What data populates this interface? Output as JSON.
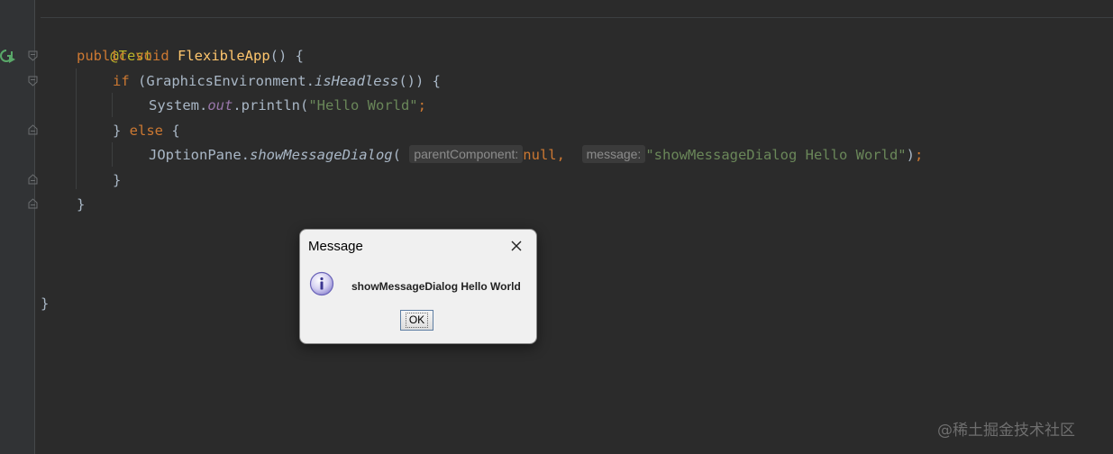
{
  "code": {
    "line1": {
      "annotation": "@Test"
    },
    "line2": {
      "kw_public": "public",
      "kw_void": "void",
      "method_name": "FlexibleApp",
      "rest": "() {"
    },
    "line3": {
      "kw_if": "if",
      "open": " (GraphicsEnvironment.",
      "call": "isHeadless",
      "close": "()) {"
    },
    "line4": {
      "prefix": "System.",
      "field": "out",
      "mid": ".println(",
      "string": "\"Hello World\"",
      "semi": ";"
    },
    "line5": {
      "close": "} ",
      "kw_else": "else",
      "open": " {"
    },
    "line6": {
      "prefix": "JOptionPane.",
      "call": "showMessageDialog",
      "paren": "(",
      "hint1": "parentComponent:",
      "kw_null": "null,",
      "hint2": "message:",
      "string": "\"showMessageDialog Hello World\"",
      "end": ")",
      "semi": ";"
    },
    "line7": {
      "text": "}"
    },
    "line8": {
      "text": "}"
    },
    "line9": {
      "text": "}"
    }
  },
  "dialog": {
    "title": "Message",
    "message": "showMessageDialog Hello World",
    "ok_label": "OK",
    "icon": "info-icon",
    "close_icon": "close-icon"
  },
  "watermark": {
    "text": "@稀土掘金技术社区"
  },
  "colors": {
    "editor_bg": "#2b2b2b",
    "keyword": "#cc7832",
    "annotation": "#bbb529",
    "method": "#ffc66d",
    "field": "#9876aa",
    "string": "#6a8759",
    "text": "#a9b7c6"
  }
}
